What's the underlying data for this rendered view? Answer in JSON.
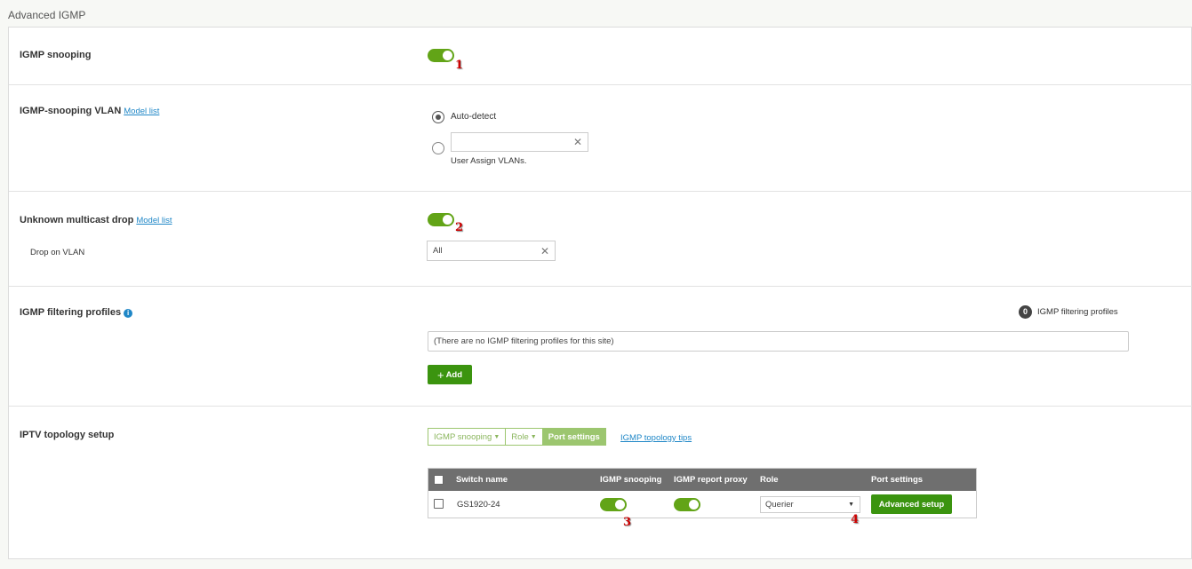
{
  "page_title": "Advanced IGMP",
  "sections": {
    "igmp_snooping": {
      "label": "IGMP snooping",
      "enabled": true,
      "annotation": "1"
    },
    "snooping_vlan": {
      "label": "IGMP-snooping VLAN",
      "link": "Model list",
      "options": [
        {
          "label": "Auto-detect",
          "selected": true
        },
        {
          "label": "User Assign VLANs.",
          "selected": false,
          "input_value": ""
        }
      ]
    },
    "unknown_multicast": {
      "label": "Unknown multicast drop",
      "link": "Model list",
      "enabled": true,
      "annotation": "2",
      "drop_on_vlan_label": "Drop on VLAN",
      "drop_on_vlan_value": "All"
    },
    "filtering_profiles": {
      "label": "IGMP filtering profiles",
      "info_icon": "i",
      "count": "0",
      "count_label": "IGMP filtering profiles",
      "empty_text": "(There are no IGMP filtering profiles for this site)",
      "add_label": "Add"
    },
    "iptv": {
      "label": "IPTV topology setup",
      "tabs": [
        {
          "label": "IGMP snooping",
          "dropdown": true,
          "active": false
        },
        {
          "label": "Role",
          "dropdown": true,
          "active": false
        },
        {
          "label": "Port settings",
          "dropdown": false,
          "active": true
        }
      ],
      "tips_link": "IGMP topology tips",
      "table": {
        "headers": [
          "Switch name",
          "IGMP snooping",
          "IGMP report proxy",
          "Role",
          "Port settings"
        ],
        "rows": [
          {
            "switch_name": "GS1920-24",
            "igmp_snooping": true,
            "igmp_report_proxy": true,
            "role": "Querier",
            "port_settings_button": "Advanced setup",
            "annotation_snooping": "3",
            "annotation_role": "4"
          }
        ]
      }
    }
  },
  "colors": {
    "toggle_on": "#62a417",
    "button_green": "#3b940f",
    "table_header": "#6f6f6f",
    "link": "#1f87c7",
    "annotation": "#cc0000"
  }
}
